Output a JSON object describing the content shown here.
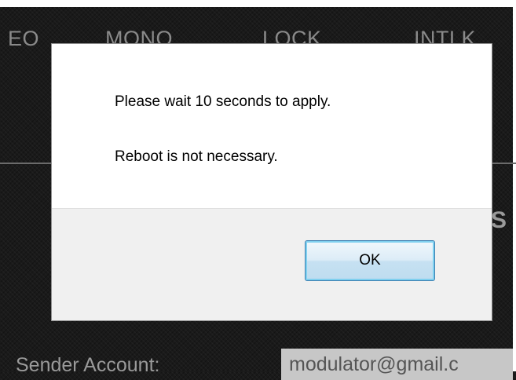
{
  "background": {
    "tabs": [
      "EO",
      "MONO",
      "LOCK",
      "INTLK"
    ],
    "partial_letter": "S",
    "sender_label": "Sender Account:",
    "sender_value": "modulator@gmail.c"
  },
  "dialog": {
    "message_line_1": "Please wait 10 seconds to apply.",
    "message_line_2": "Reboot is not necessary.",
    "ok_label": "OK"
  },
  "colors": {
    "background": "#1a1a1a",
    "dialog_body": "#ffffff",
    "dialog_footer": "#f0f0f0",
    "button_border": "#3c7fb1",
    "field_background": "#c7c7c7"
  }
}
